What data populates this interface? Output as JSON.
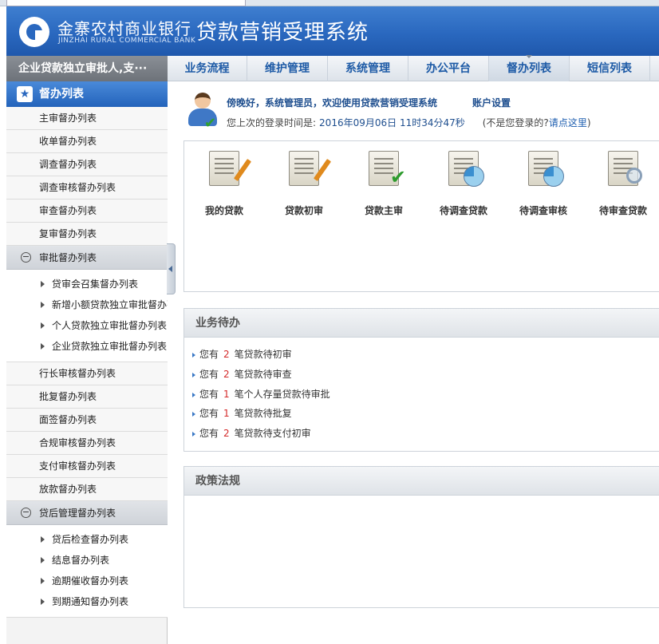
{
  "header": {
    "bank_name_cn": "金寨农村商业银行",
    "bank_name_en": "JINZHAI RURAL COMMERCIAL BANK",
    "system_title": "贷款营销受理系统",
    "logo_icon": "bank-logo-icon",
    "brand_color": "#2a68bf"
  },
  "user_bar": {
    "text": "企业贷款独立审批人,支···"
  },
  "nav": {
    "items": [
      {
        "label": "业务流程"
      },
      {
        "label": "维护管理"
      },
      {
        "label": "系统管理"
      },
      {
        "label": "办公平台"
      },
      {
        "label": "督办列表",
        "active": true
      },
      {
        "label": "短信列表"
      }
    ]
  },
  "sidebar": {
    "header": "督办列表",
    "items_top": [
      "主审督办列表",
      "收单督办列表",
      "调查督办列表",
      "调查审核督办列表",
      "审查督办列表",
      "复审督办列表"
    ],
    "group1": {
      "label": "审批督办列表",
      "subs": [
        "贷审会召集督办列表",
        "新增小额贷款独立审批督办列表",
        "个人贷款独立审批督办列表",
        "企业贷款独立审批督办列表"
      ]
    },
    "items_mid": [
      "行长审核督办列表",
      "批复督办列表",
      "面签督办列表",
      "合规审核督办列表",
      "支付审核督办列表",
      "放款督办列表"
    ],
    "group2": {
      "label": "贷后管理督办列表",
      "subs": [
        "贷后检查督办列表",
        "结息督办列表",
        "逾期催收督办列表",
        "到期通知督办列表"
      ]
    }
  },
  "welcome": {
    "greeting": "傍晚好，系统管理员，欢迎使用贷款营销受理系统",
    "account_settings": "账户设置",
    "last_login_label": "您上次的登录时间是:",
    "last_login_time": "2016年09月06日 11时34分47秒",
    "not_you": "(不是您登录的?",
    "click_here": "请点这里",
    "close_paren": ")"
  },
  "quick_icons": [
    {
      "label": "我的贷款",
      "icon": "edit-document-icon"
    },
    {
      "label": "贷款初审",
      "icon": "edit-document-icon"
    },
    {
      "label": "贷款主审",
      "icon": "approve-document-icon"
    },
    {
      "label": "待调查贷款",
      "icon": "pie-chart-document-icon"
    },
    {
      "label": "待调查审核",
      "icon": "pie-chart-document-icon"
    },
    {
      "label": "待审查贷款",
      "icon": "search-document-icon"
    }
  ],
  "todo_panel": {
    "title": "业务待办",
    "items": [
      {
        "prefix": "您有",
        "count": "2",
        "suffix": "笔贷款待初审"
      },
      {
        "prefix": "您有",
        "count": "2",
        "suffix": "笔贷款待审查"
      },
      {
        "prefix": "您有",
        "count": "1",
        "suffix": "笔个人存量贷款待审批"
      },
      {
        "prefix": "您有",
        "count": "1",
        "suffix": "笔贷款待批复"
      },
      {
        "prefix": "您有",
        "count": "2",
        "suffix": "笔贷款待支付初审"
      }
    ]
  },
  "policy_panel": {
    "title": "政策法规"
  }
}
